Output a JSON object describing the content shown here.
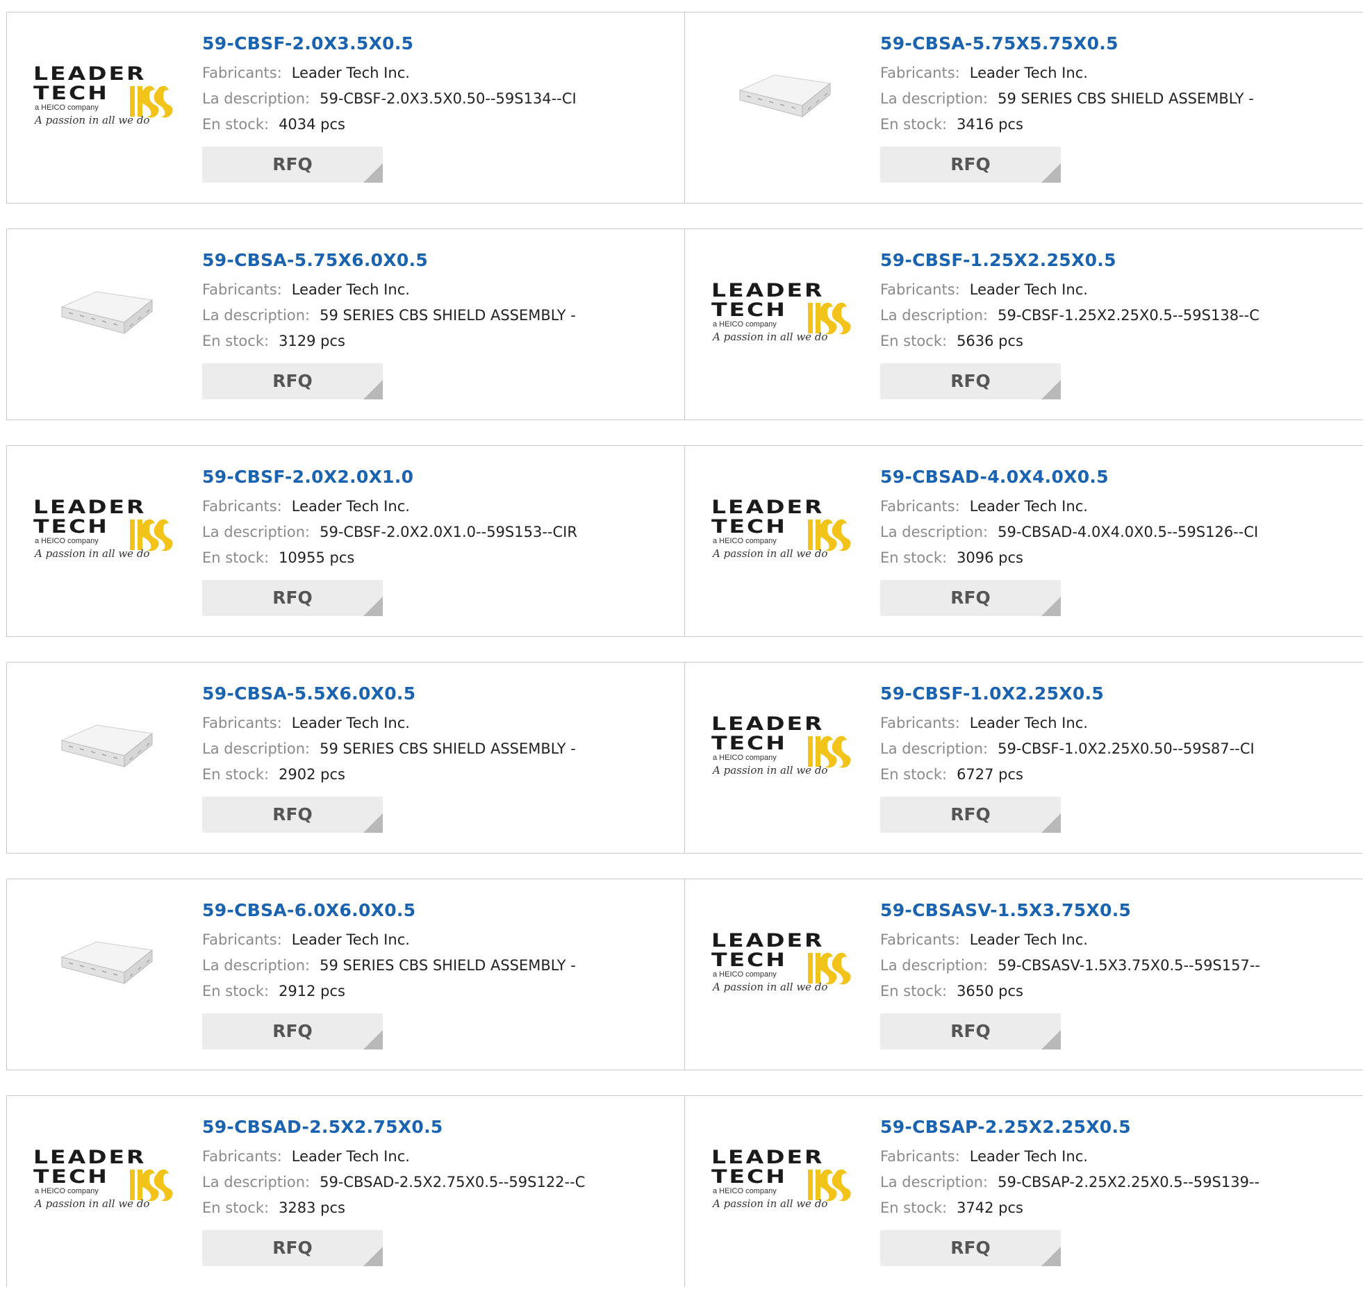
{
  "labels": {
    "manufacturer": "Fabricants:",
    "description": "La description:",
    "stock": "En stock:",
    "rfq": "RFQ"
  },
  "logo": {
    "line1": "LEADER",
    "line2": "TECH",
    "heico": "a HEICO company",
    "tagline": "A passion in all we do"
  },
  "colors": {
    "link": "#1a63b0",
    "label": "#8a8a8a",
    "border": "#c9c9c9",
    "button": "#ececec",
    "logo_yellow": "#f2c318"
  },
  "products": [
    {
      "part": "59-CBSF-2.0X3.5X0.5",
      "image": "leader-tech-logo",
      "manufacturer": "Leader Tech Inc.",
      "description": "59-CBSF-2.0X3.5X0.50--59S134--CI",
      "stock": "4034 pcs"
    },
    {
      "part": "59-CBSA-5.75X5.75X0.5",
      "image": "shield-box-photo",
      "manufacturer": "Leader Tech Inc.",
      "description": "59 SERIES CBS SHIELD ASSEMBLY -",
      "stock": "3416 pcs"
    },
    {
      "part": "59-CBSA-5.75X6.0X0.5",
      "image": "shield-box-photo",
      "manufacturer": "Leader Tech Inc.",
      "description": "59 SERIES CBS SHIELD ASSEMBLY -",
      "stock": "3129 pcs"
    },
    {
      "part": "59-CBSF-1.25X2.25X0.5",
      "image": "leader-tech-logo",
      "manufacturer": "Leader Tech Inc.",
      "description": "59-CBSF-1.25X2.25X0.5--59S138--C",
      "stock": "5636 pcs"
    },
    {
      "part": "59-CBSF-2.0X2.0X1.0",
      "image": "leader-tech-logo",
      "manufacturer": "Leader Tech Inc.",
      "description": "59-CBSF-2.0X2.0X1.0--59S153--CIR",
      "stock": "10955 pcs"
    },
    {
      "part": "59-CBSAD-4.0X4.0X0.5",
      "image": "leader-tech-logo",
      "manufacturer": "Leader Tech Inc.",
      "description": "59-CBSAD-4.0X4.0X0.5--59S126--CI",
      "stock": "3096 pcs"
    },
    {
      "part": "59-CBSA-5.5X6.0X0.5",
      "image": "shield-box-photo",
      "manufacturer": "Leader Tech Inc.",
      "description": "59 SERIES CBS SHIELD ASSEMBLY -",
      "stock": "2902 pcs"
    },
    {
      "part": "59-CBSF-1.0X2.25X0.5",
      "image": "leader-tech-logo",
      "manufacturer": "Leader Tech Inc.",
      "description": "59-CBSF-1.0X2.25X0.50--59S87--CI",
      "stock": "6727 pcs"
    },
    {
      "part": "59-CBSA-6.0X6.0X0.5",
      "image": "shield-box-photo",
      "manufacturer": "Leader Tech Inc.",
      "description": "59 SERIES CBS SHIELD ASSEMBLY -",
      "stock": "2912 pcs"
    },
    {
      "part": "59-CBSASV-1.5X3.75X0.5",
      "image": "leader-tech-logo",
      "manufacturer": "Leader Tech Inc.",
      "description": "59-CBSASV-1.5X3.75X0.5--59S157--",
      "stock": "3650 pcs"
    },
    {
      "part": "59-CBSAD-2.5X2.75X0.5",
      "image": "leader-tech-logo",
      "manufacturer": "Leader Tech Inc.",
      "description": "59-CBSAD-2.5X2.75X0.5--59S122--C",
      "stock": "3283 pcs"
    },
    {
      "part": "59-CBSAP-2.25X2.25X0.5",
      "image": "leader-tech-logo",
      "manufacturer": "Leader Tech Inc.",
      "description": "59-CBSAP-2.25X2.25X0.5--59S139--",
      "stock": "3742 pcs"
    }
  ]
}
